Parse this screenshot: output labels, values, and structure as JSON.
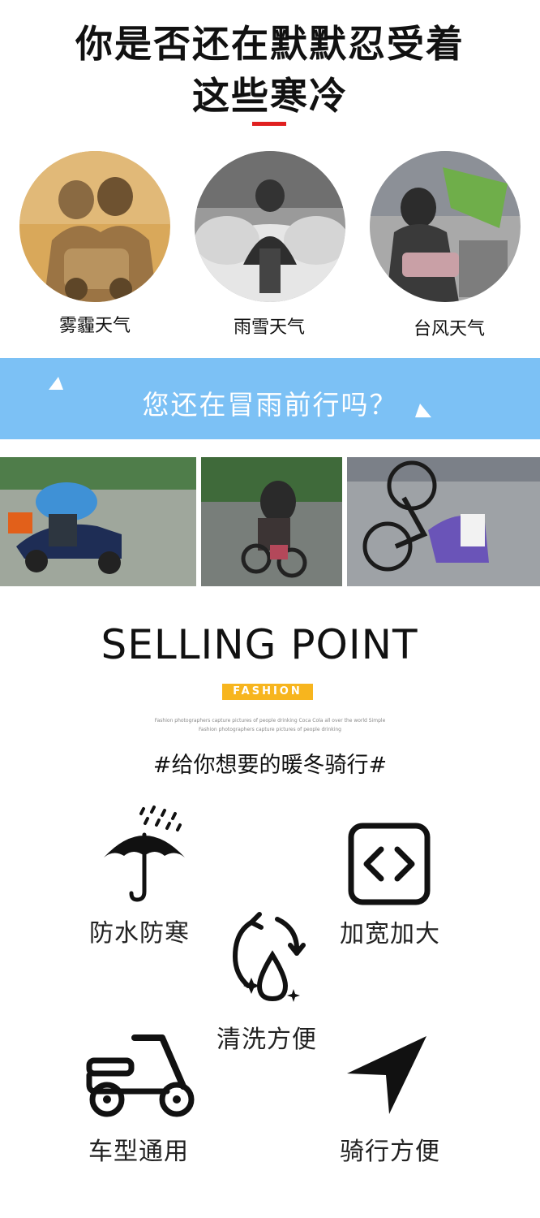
{
  "headline": {
    "line1": "你是否还在默默忍受着",
    "line2": "这些寒冷"
  },
  "weather_cards": [
    {
      "label": "雾霾天气"
    },
    {
      "label": "雨雪天气"
    },
    {
      "label": "台风天气"
    }
  ],
  "banner": {
    "text": "您还在冒雨前行吗？"
  },
  "selling": {
    "title": "SELLING POINT",
    "badge": "FASHION",
    "fineprint_line1": "Fashion photographers capture pictures of people drinking Coca Cola all over the world Simple",
    "fineprint_line2": "Fashion photographers capture pictures of people drinking",
    "hashtag": "#给你想要的暖冬骑行#"
  },
  "features": [
    {
      "label": "防水防寒",
      "icon": "umbrella-rain-icon"
    },
    {
      "label": "加宽加大",
      "icon": "expand-arrows-icon"
    },
    {
      "label": "清洗方便",
      "icon": "wash-droplet-icon"
    },
    {
      "label": "车型通用",
      "icon": "scooter-icon"
    },
    {
      "label": "骑行方便",
      "icon": "navigation-arrow-icon"
    }
  ],
  "colors": {
    "accent_red": "#e02020",
    "banner_blue": "#7cc1f5",
    "badge_yellow": "#f7b51e"
  }
}
